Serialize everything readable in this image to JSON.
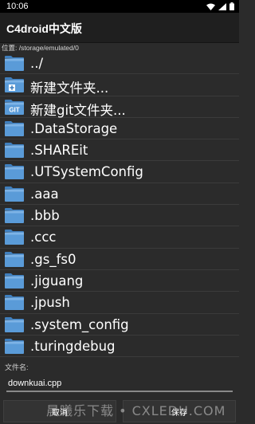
{
  "status_bar": {
    "time": "10:06",
    "icons": [
      "wifi-icon",
      "signal-icon",
      "battery-icon"
    ]
  },
  "app_bar": {
    "title": "C4droid中文版"
  },
  "path_bar": {
    "text": "位置: /storage/emulated/0"
  },
  "file_list": [
    {
      "label": "../",
      "icon": "folder-up-icon"
    },
    {
      "label": "新建文件夹...",
      "icon": "new-folder-icon"
    },
    {
      "label": "新建git文件夹...",
      "icon": "git-folder-icon"
    },
    {
      "label": ".DataStorage",
      "icon": "folder-icon"
    },
    {
      "label": ".SHAREit",
      "icon": "folder-icon"
    },
    {
      "label": ".UTSystemConfig",
      "icon": "folder-icon"
    },
    {
      "label": ".aaa",
      "icon": "folder-icon"
    },
    {
      "label": ".bbb",
      "icon": "folder-icon"
    },
    {
      "label": ".ccc",
      "icon": "folder-icon"
    },
    {
      "label": ".gs_fs0",
      "icon": "folder-icon"
    },
    {
      "label": ".jiguang",
      "icon": "folder-icon"
    },
    {
      "label": ".jpush",
      "icon": "folder-icon"
    },
    {
      "label": ".system_config",
      "icon": "folder-icon"
    },
    {
      "label": ".turingdebug",
      "icon": "folder-icon"
    }
  ],
  "filename": {
    "label": "文件名:",
    "value": "downkuai.cpp"
  },
  "buttons": {
    "cancel": "取消",
    "save": "保存"
  },
  "watermark": "晨曦乐下载 • CXLEDU.COM",
  "colors": {
    "folder": "#5a9bd8",
    "background": "#2b2b2b",
    "app_bar": "#1f1f1f"
  }
}
